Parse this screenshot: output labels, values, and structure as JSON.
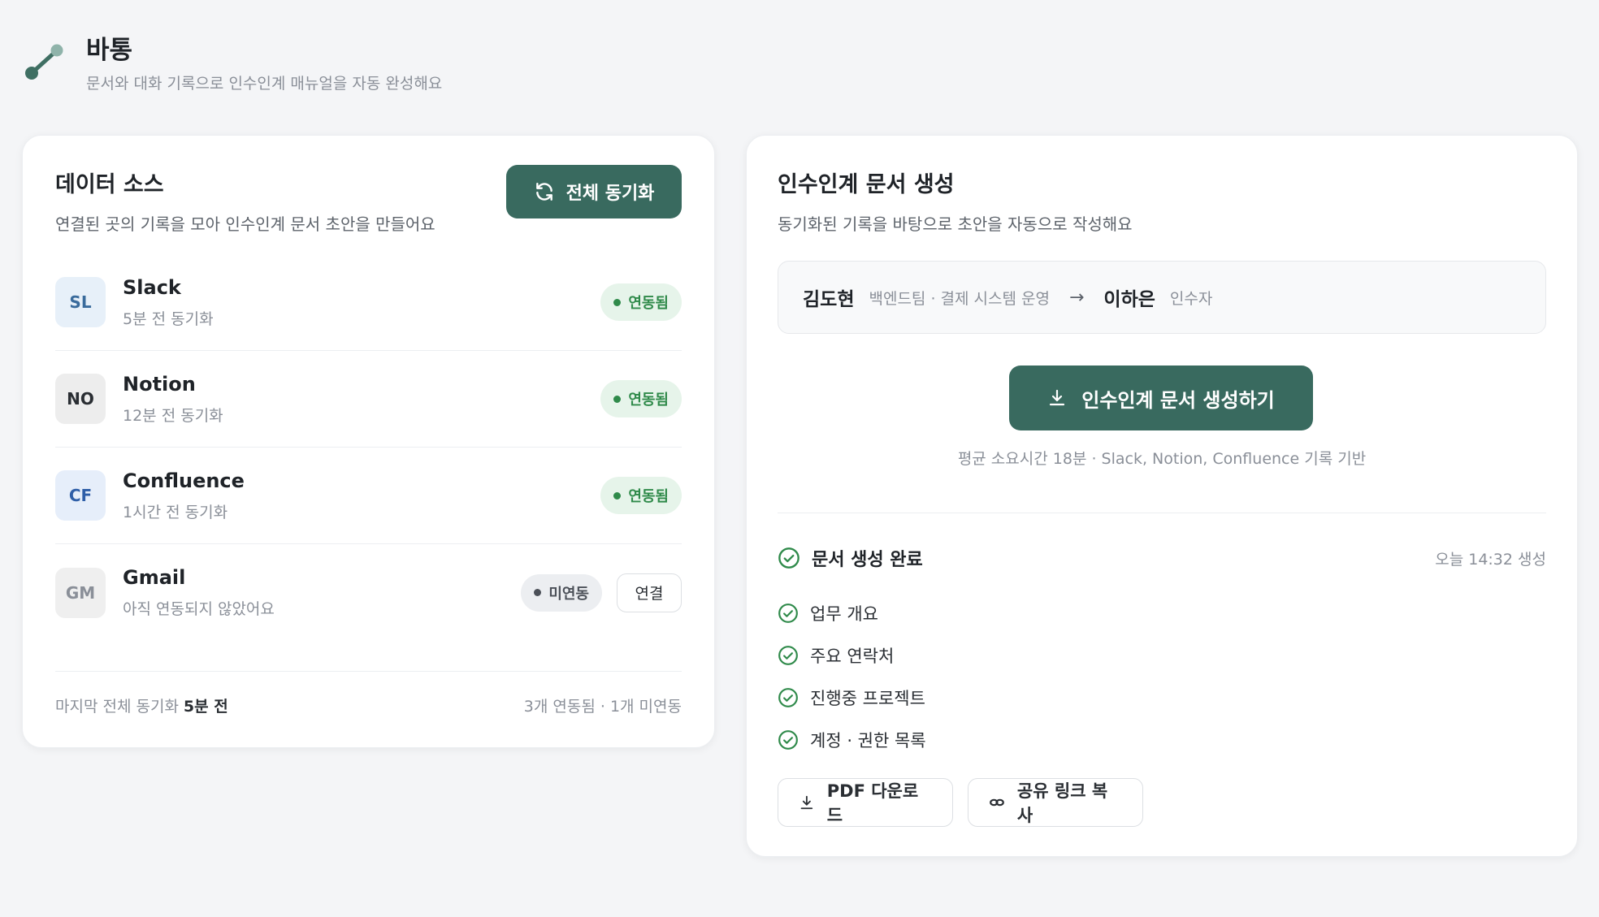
{
  "app": {
    "title": "바통",
    "subtitle": "문서와 대화 기록으로 인수인계 매뉴얼을 자동 완성해요",
    "accent": "#396a5f"
  },
  "sources_panel": {
    "title": "데이터 소스",
    "description": "연결된 곳의 기록을 모아 인수인계 문서 초안을 만들어요",
    "sync_all_label": "전체 동기화",
    "sources": [
      {
        "abbr": "SL",
        "name": "Slack",
        "sync": "5분 전 동기화",
        "status": "연동됨",
        "connected": true
      },
      {
        "abbr": "NO",
        "name": "Notion",
        "sync": "12분 전 동기화",
        "status": "연동됨",
        "connected": true
      },
      {
        "abbr": "CF",
        "name": "Confluence",
        "sync": "1시간 전 동기화",
        "status": "연동됨",
        "connected": true
      },
      {
        "abbr": "GM",
        "name": "Gmail",
        "sync": "아직 연동되지 않았어요",
        "status": "미연동",
        "connected": false,
        "action_label": "연결"
      }
    ],
    "footer_label": "마지막 전체 동기화",
    "footer_time": "5분 전",
    "footer_summary": "3개 연동됨 · 1개 미연동"
  },
  "generate_panel": {
    "title": "인수인계 문서 생성",
    "description": "동기화된 기록을 바탕으로 초안을 자동으로 작성해요",
    "from_name": "김도현",
    "from_role": "백엔드팀 · 결제 시스템 운영",
    "to_name": "이하은",
    "to_role": "인수자",
    "generate_label": "인수인계 문서 생성하기",
    "generate_note": "평균 소요시간 18분 · Slack, Notion, Confluence 기록 기반",
    "done_title": "문서 생성 완료",
    "done_time": "오늘 14:32 생성",
    "sections": [
      "업무 개요",
      "주요 연락처",
      "진행중 프로젝트",
      "계정 · 권한 목록"
    ],
    "pdf_label": "PDF 다운로드",
    "share_label": "공유 링크 복사"
  }
}
